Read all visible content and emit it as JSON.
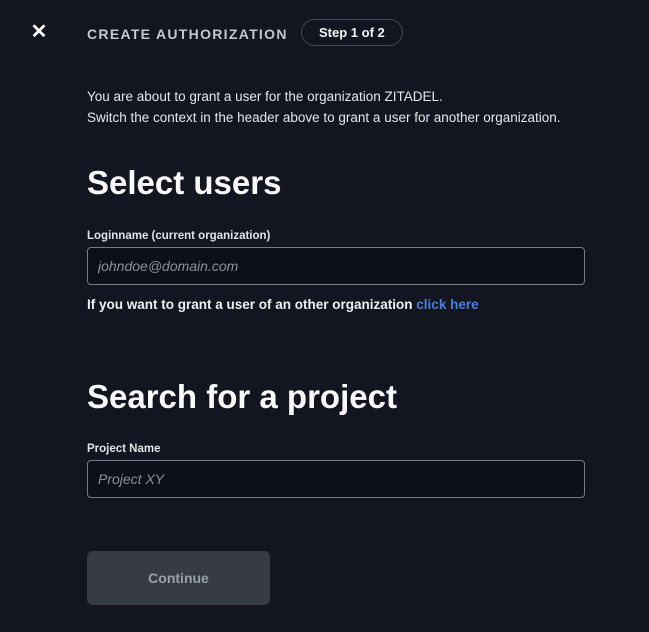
{
  "header": {
    "close_glyph": "✕",
    "title": "CREATE AUTHORIZATION",
    "step_badge": "Step 1 of 2"
  },
  "intro": {
    "line1": "You are about to grant a user for the organization ZITADEL.",
    "line2": "Switch the context in the header above to grant a user for another organization."
  },
  "select_users": {
    "heading": "Select users",
    "label": "Loginname (current organization)",
    "placeholder": "johndoe@domain.com",
    "value": "",
    "hint_text": "If you want to grant a user of an other organization",
    "hint_link": "click here"
  },
  "project_search": {
    "heading": "Search for a project",
    "label": "Project Name",
    "placeholder": "Project XY",
    "value": ""
  },
  "footer": {
    "continue_label": "Continue"
  },
  "colors": {
    "background": "#131621",
    "link": "#4a7fd9",
    "input_border": "#767b85",
    "input_background": "#0d1019",
    "button_background": "#363b45",
    "button_text": "#9aa0a9",
    "pill_border": "#434956"
  }
}
